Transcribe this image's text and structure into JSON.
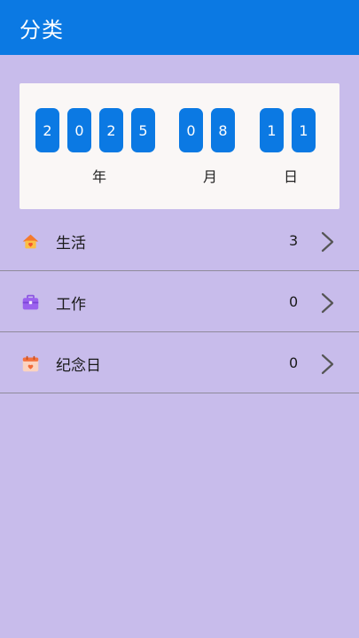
{
  "app_bar": {
    "title": "分类"
  },
  "date": {
    "year_digits": [
      "2",
      "0",
      "2",
      "5"
    ],
    "month_digits": [
      "0",
      "8"
    ],
    "day_digits": [
      "1",
      "1"
    ],
    "year_unit": "年",
    "month_unit": "月",
    "day_unit": "日"
  },
  "categories": [
    {
      "icon": "house-icon",
      "label": "生活",
      "count": "3"
    },
    {
      "icon": "briefcase-icon",
      "label": "工作",
      "count": "0"
    },
    {
      "icon": "calendar-heart-icon",
      "label": "纪念日",
      "count": "0"
    }
  ],
  "colors": {
    "accent": "#0b79e3",
    "background": "#c8bceb",
    "card": "#faf7f6"
  }
}
